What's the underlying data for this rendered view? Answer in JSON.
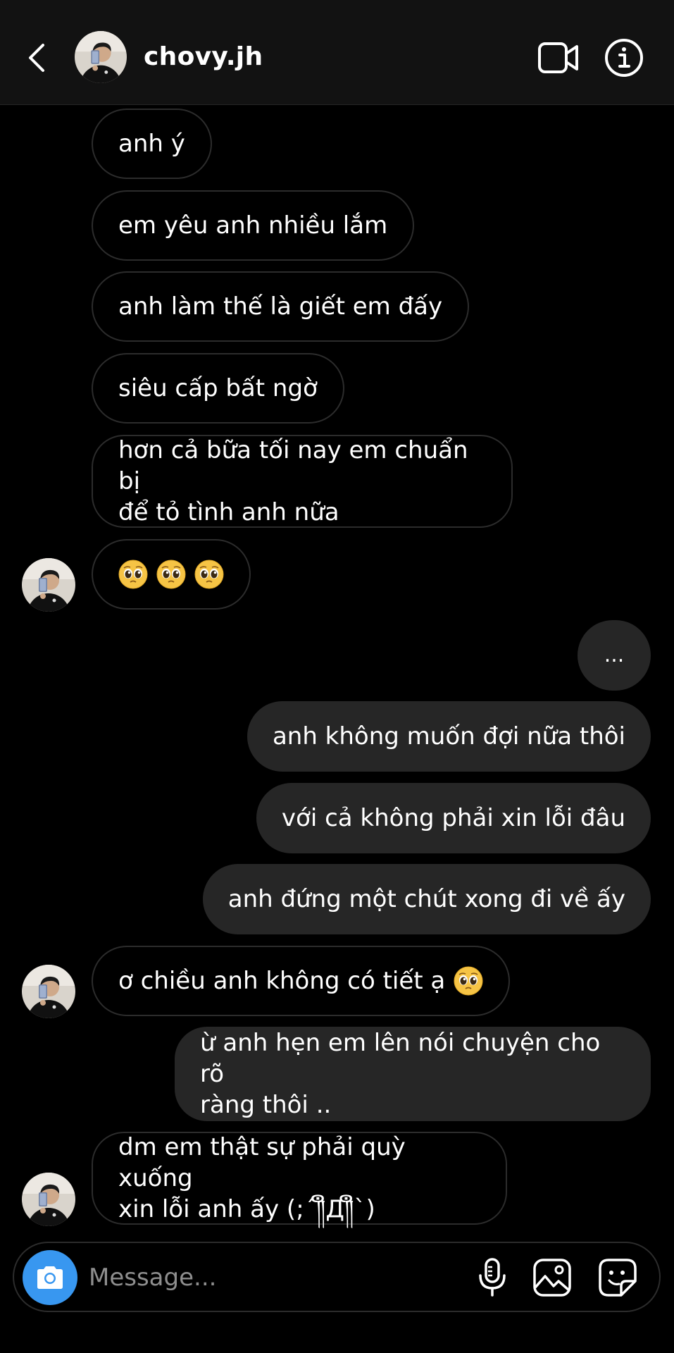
{
  "header": {
    "contact_name": "chovy.jh"
  },
  "messages": {
    "m1": "anh ý",
    "m2": "em yêu anh nhiều lắm",
    "m3": "anh làm thế là giết em đấy",
    "m4": "siêu cấp bất ngờ",
    "m5_line1": "hơn cả bữa tối nay em chuẩn bị",
    "m5_line2": "để tỏ tình anh nữa",
    "m7": "...",
    "m8": "anh không muốn đợi nữa thôi",
    "m9": "với cả không phải xin lỗi đâu",
    "m10": "anh đứng một chút xong đi về ấy",
    "m11": "ơ chiều anh không có tiết ạ",
    "m12_line1": "ừ anh hẹn em lên nói chuyện cho rõ",
    "m12_line2": "ràng thôi ..",
    "m13_line1": "dm em thật sự phải quỳ xuống",
    "m13_line2": "xin lỗi anh ấy (;´༎ຶД༎ຶ`)"
  },
  "composer": {
    "placeholder": "Message..."
  },
  "icons": {
    "back": "chevron-left-icon",
    "video": "video-camera-icon",
    "info": "info-icon",
    "camera": "camera-icon",
    "mic": "microphone-icon",
    "gallery": "image-icon",
    "sticker": "sticker-icon",
    "emoji": "pleading-face-emoji"
  },
  "colors": {
    "background": "#000000",
    "header": "#121212",
    "outgoing_bubble": "#262626",
    "incoming_border": "#2c2c2c",
    "camera_button": "#3897f0"
  }
}
